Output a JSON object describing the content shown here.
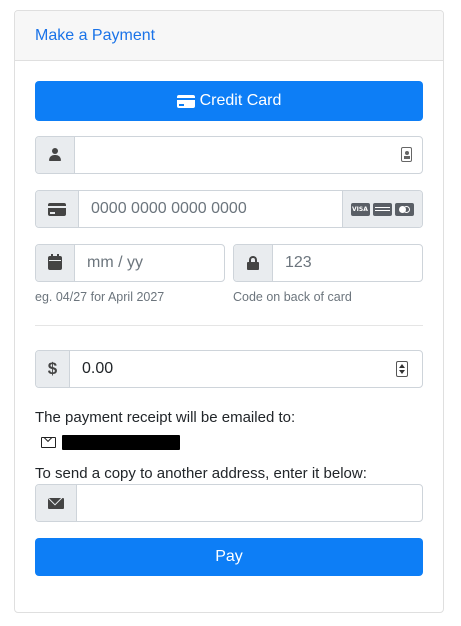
{
  "header": {
    "title": "Make a Payment"
  },
  "payment_method": {
    "label": "Credit Card"
  },
  "fields": {
    "name": {
      "placeholder": "",
      "value": ""
    },
    "card_number": {
      "placeholder": "0000 0000 0000 0000"
    },
    "expiry": {
      "placeholder": "mm / yy",
      "help": "eg. 04/27 for April 2027"
    },
    "cvv": {
      "placeholder": "123",
      "help": "Code on back of card"
    },
    "amount": {
      "value": "0.00"
    },
    "copy_email": {
      "value": ""
    }
  },
  "receipt": {
    "notice": "The payment receipt will be emailed to:",
    "copy_prompt": "To send a copy to another address, enter it below:"
  },
  "actions": {
    "pay_label": "Pay"
  },
  "colors": {
    "primary": "#0d7ef6",
    "title": "#1a73e8"
  },
  "icons": {
    "card_brands": [
      "visa-icon",
      "amex-icon",
      "mastercard-icon"
    ]
  }
}
